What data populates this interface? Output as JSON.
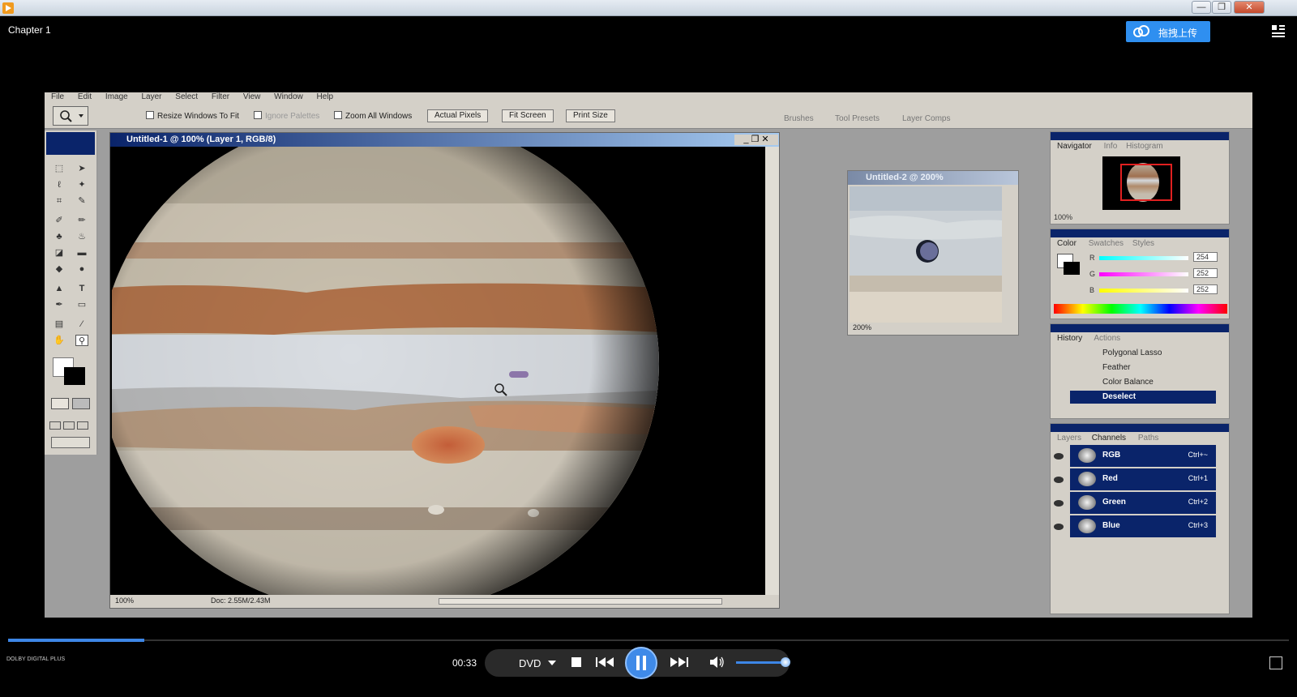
{
  "window": {
    "minimize": "—",
    "restore": "❐",
    "close": "✕"
  },
  "header": {
    "title": "Chapter 1",
    "upload_label": "拖拽上传"
  },
  "photoshop": {
    "menu": [
      "File",
      "Edit",
      "Image",
      "Layer",
      "Select",
      "Filter",
      "View",
      "Window",
      "Help"
    ],
    "options": {
      "resize_windows": "Resize Windows To Fit",
      "ignore_palettes": "Ignore Palettes",
      "zoom_all": "Zoom All Windows",
      "actual_pixels": "Actual Pixels",
      "fit_screen": "Fit Screen",
      "print_size": "Print Size"
    },
    "palette_well": [
      "Brushes",
      "Tool Presets",
      "Layer Comps"
    ],
    "doc1": {
      "title": "Untitled-1 @ 100% (Layer 1, RGB/8)",
      "zoom": "100%",
      "doc_size": "Doc: 2.55M/2.43M"
    },
    "doc2": {
      "title": "Untitled-2 @ 200%",
      "zoom": "200%"
    },
    "navigator": {
      "tabs": [
        "Navigator",
        "Info",
        "Histogram"
      ],
      "zoom": "100%"
    },
    "color": {
      "tabs": [
        "Color",
        "Swatches",
        "Styles"
      ],
      "r_label": "R",
      "g_label": "G",
      "b_label": "B",
      "r": "254",
      "g": "252",
      "b": "252"
    },
    "history": {
      "tabs": [
        "History",
        "Actions"
      ],
      "items": [
        "Polygonal Lasso",
        "Feather",
        "Color Balance",
        "Deselect"
      ]
    },
    "channels": {
      "tabs": [
        "Layers",
        "Channels",
        "Paths"
      ],
      "rows": [
        {
          "name": "RGB",
          "shortcut": "Ctrl+~"
        },
        {
          "name": "Red",
          "shortcut": "Ctrl+1"
        },
        {
          "name": "Green",
          "shortcut": "Ctrl+2"
        },
        {
          "name": "Blue",
          "shortcut": "Ctrl+3"
        }
      ]
    }
  },
  "player": {
    "time": "00:33",
    "progress": 0.1,
    "volume": 1.0,
    "source": "DVD",
    "dolby": "DOLBY DIGITAL PLUS",
    "colors": {
      "accent": "#3d86e6",
      "ps_highlight": "#0a246a"
    }
  }
}
